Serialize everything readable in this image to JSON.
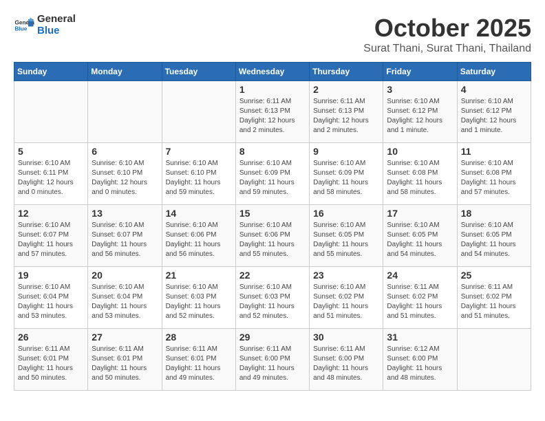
{
  "header": {
    "logo_general": "General",
    "logo_blue": "Blue",
    "month": "October 2025",
    "location": "Surat Thani, Surat Thani, Thailand"
  },
  "weekdays": [
    "Sunday",
    "Monday",
    "Tuesday",
    "Wednesday",
    "Thursday",
    "Friday",
    "Saturday"
  ],
  "weeks": [
    [
      {
        "day": "",
        "info": ""
      },
      {
        "day": "",
        "info": ""
      },
      {
        "day": "",
        "info": ""
      },
      {
        "day": "1",
        "info": "Sunrise: 6:11 AM\nSunset: 6:13 PM\nDaylight: 12 hours and 2 minutes."
      },
      {
        "day": "2",
        "info": "Sunrise: 6:11 AM\nSunset: 6:13 PM\nDaylight: 12 hours and 2 minutes."
      },
      {
        "day": "3",
        "info": "Sunrise: 6:10 AM\nSunset: 6:12 PM\nDaylight: 12 hours and 1 minute."
      },
      {
        "day": "4",
        "info": "Sunrise: 6:10 AM\nSunset: 6:12 PM\nDaylight: 12 hours and 1 minute."
      }
    ],
    [
      {
        "day": "5",
        "info": "Sunrise: 6:10 AM\nSunset: 6:11 PM\nDaylight: 12 hours and 0 minutes."
      },
      {
        "day": "6",
        "info": "Sunrise: 6:10 AM\nSunset: 6:10 PM\nDaylight: 12 hours and 0 minutes."
      },
      {
        "day": "7",
        "info": "Sunrise: 6:10 AM\nSunset: 6:10 PM\nDaylight: 11 hours and 59 minutes."
      },
      {
        "day": "8",
        "info": "Sunrise: 6:10 AM\nSunset: 6:09 PM\nDaylight: 11 hours and 59 minutes."
      },
      {
        "day": "9",
        "info": "Sunrise: 6:10 AM\nSunset: 6:09 PM\nDaylight: 11 hours and 58 minutes."
      },
      {
        "day": "10",
        "info": "Sunrise: 6:10 AM\nSunset: 6:08 PM\nDaylight: 11 hours and 58 minutes."
      },
      {
        "day": "11",
        "info": "Sunrise: 6:10 AM\nSunset: 6:08 PM\nDaylight: 11 hours and 57 minutes."
      }
    ],
    [
      {
        "day": "12",
        "info": "Sunrise: 6:10 AM\nSunset: 6:07 PM\nDaylight: 11 hours and 57 minutes."
      },
      {
        "day": "13",
        "info": "Sunrise: 6:10 AM\nSunset: 6:07 PM\nDaylight: 11 hours and 56 minutes."
      },
      {
        "day": "14",
        "info": "Sunrise: 6:10 AM\nSunset: 6:06 PM\nDaylight: 11 hours and 56 minutes."
      },
      {
        "day": "15",
        "info": "Sunrise: 6:10 AM\nSunset: 6:06 PM\nDaylight: 11 hours and 55 minutes."
      },
      {
        "day": "16",
        "info": "Sunrise: 6:10 AM\nSunset: 6:05 PM\nDaylight: 11 hours and 55 minutes."
      },
      {
        "day": "17",
        "info": "Sunrise: 6:10 AM\nSunset: 6:05 PM\nDaylight: 11 hours and 54 minutes."
      },
      {
        "day": "18",
        "info": "Sunrise: 6:10 AM\nSunset: 6:05 PM\nDaylight: 11 hours and 54 minutes."
      }
    ],
    [
      {
        "day": "19",
        "info": "Sunrise: 6:10 AM\nSunset: 6:04 PM\nDaylight: 11 hours and 53 minutes."
      },
      {
        "day": "20",
        "info": "Sunrise: 6:10 AM\nSunset: 6:04 PM\nDaylight: 11 hours and 53 minutes."
      },
      {
        "day": "21",
        "info": "Sunrise: 6:10 AM\nSunset: 6:03 PM\nDaylight: 11 hours and 52 minutes."
      },
      {
        "day": "22",
        "info": "Sunrise: 6:10 AM\nSunset: 6:03 PM\nDaylight: 11 hours and 52 minutes."
      },
      {
        "day": "23",
        "info": "Sunrise: 6:10 AM\nSunset: 6:02 PM\nDaylight: 11 hours and 51 minutes."
      },
      {
        "day": "24",
        "info": "Sunrise: 6:11 AM\nSunset: 6:02 PM\nDaylight: 11 hours and 51 minutes."
      },
      {
        "day": "25",
        "info": "Sunrise: 6:11 AM\nSunset: 6:02 PM\nDaylight: 11 hours and 51 minutes."
      }
    ],
    [
      {
        "day": "26",
        "info": "Sunrise: 6:11 AM\nSunset: 6:01 PM\nDaylight: 11 hours and 50 minutes."
      },
      {
        "day": "27",
        "info": "Sunrise: 6:11 AM\nSunset: 6:01 PM\nDaylight: 11 hours and 50 minutes."
      },
      {
        "day": "28",
        "info": "Sunrise: 6:11 AM\nSunset: 6:01 PM\nDaylight: 11 hours and 49 minutes."
      },
      {
        "day": "29",
        "info": "Sunrise: 6:11 AM\nSunset: 6:00 PM\nDaylight: 11 hours and 49 minutes."
      },
      {
        "day": "30",
        "info": "Sunrise: 6:11 AM\nSunset: 6:00 PM\nDaylight: 11 hours and 48 minutes."
      },
      {
        "day": "31",
        "info": "Sunrise: 6:12 AM\nSunset: 6:00 PM\nDaylight: 11 hours and 48 minutes."
      },
      {
        "day": "",
        "info": ""
      }
    ]
  ]
}
